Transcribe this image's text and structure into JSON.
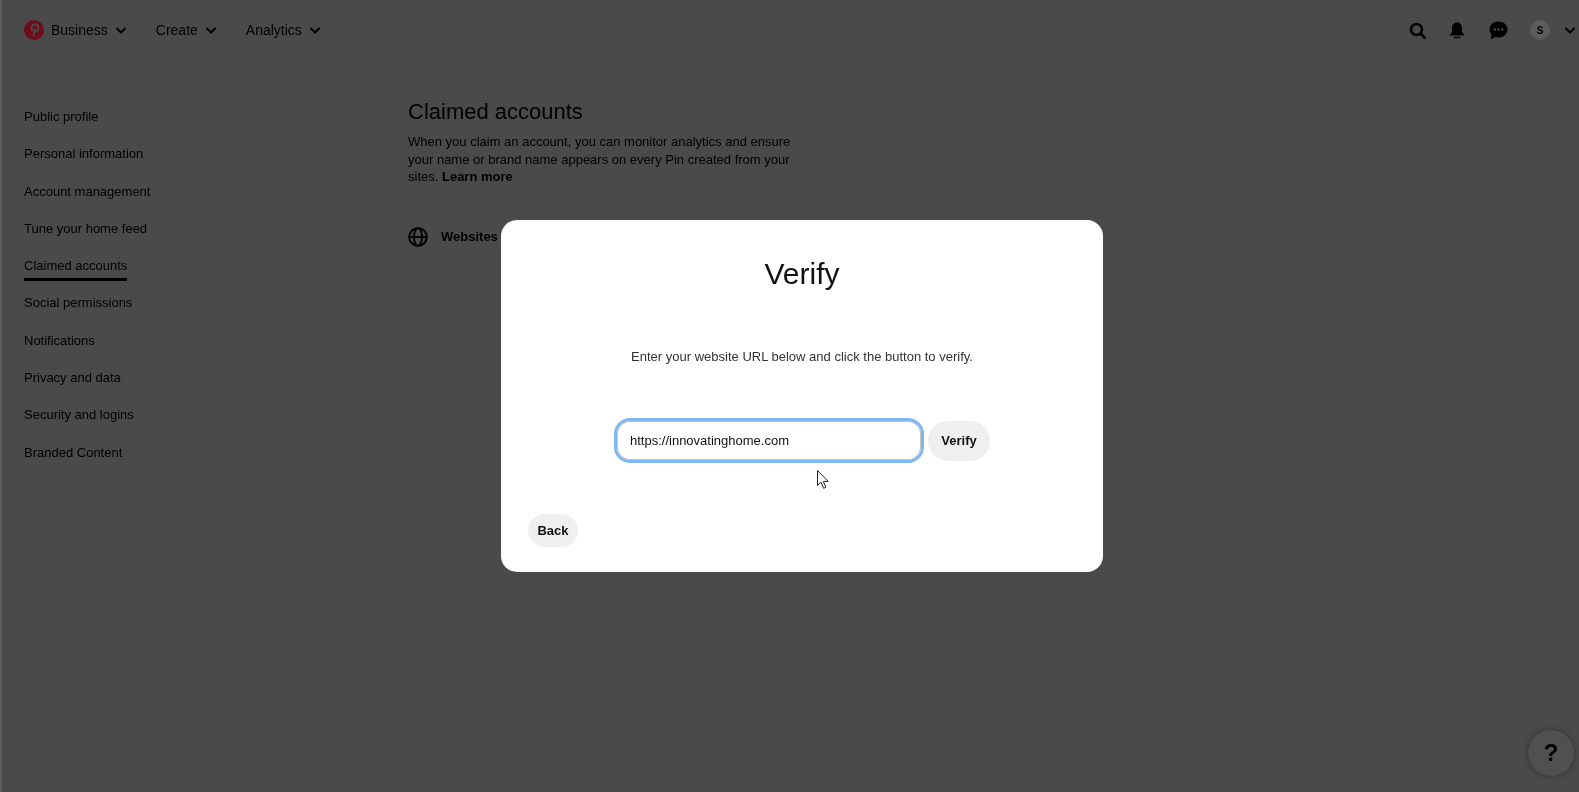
{
  "top_nav": {
    "menus": [
      {
        "label": "Business"
      },
      {
        "label": "Create"
      },
      {
        "label": "Analytics"
      }
    ],
    "avatar_initial": "S"
  },
  "sidebar": {
    "items": [
      {
        "label": "Public profile",
        "selected": false
      },
      {
        "label": "Personal information",
        "selected": false
      },
      {
        "label": "Account management",
        "selected": false
      },
      {
        "label": "Tune your home feed",
        "selected": false
      },
      {
        "label": "Claimed accounts",
        "selected": true
      },
      {
        "label": "Social permissions",
        "selected": false
      },
      {
        "label": "Notifications",
        "selected": false
      },
      {
        "label": "Privacy and data",
        "selected": false
      },
      {
        "label": "Security and logins",
        "selected": false
      },
      {
        "label": "Branded Content",
        "selected": false
      }
    ]
  },
  "main": {
    "title": "Claimed accounts",
    "description": "When you claim an account, you can monitor analytics and ensure your name or brand name appears on every Pin created from your sites.",
    "learn_more_link": "Learn more",
    "accounts": [
      {
        "label": "Websites"
      }
    ]
  },
  "modal": {
    "title": "Verify",
    "instruction": "Enter your website URL below and click the button to verify.",
    "url_field": {
      "value": "https://innovatinghome.com",
      "focused": true
    },
    "verify_button": "Verify",
    "back_button": "Back"
  },
  "help_button": "?"
}
